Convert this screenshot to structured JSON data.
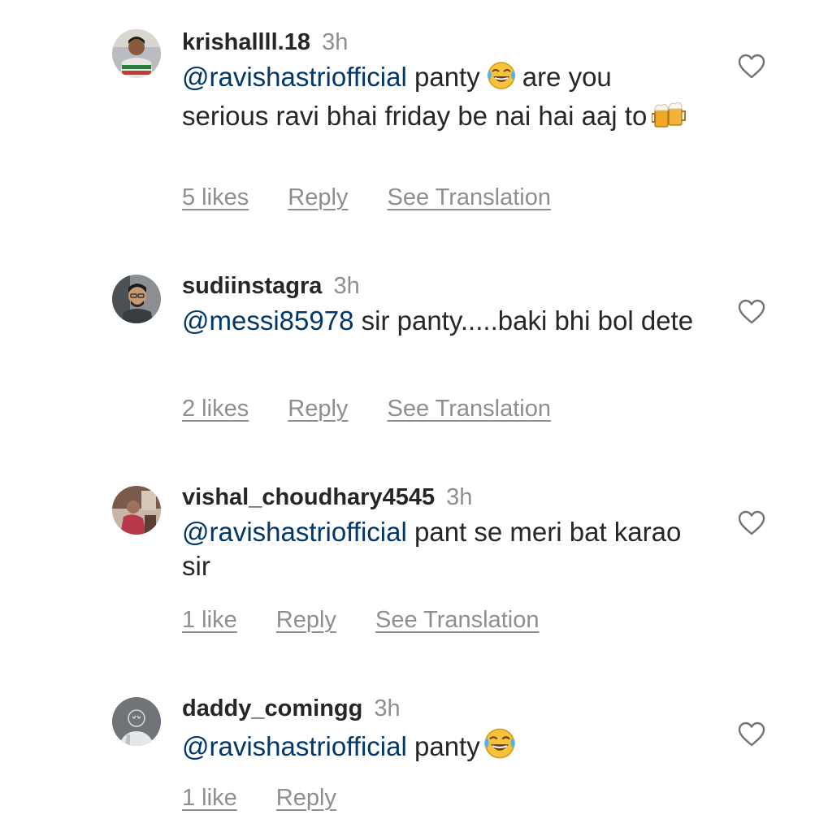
{
  "comments": [
    {
      "username": "krishallll.18",
      "time": "3h",
      "mention": "@ravishastriofficial",
      "text_before_emoji": "panty",
      "text_after_emoji": "are you serious ravi bhai friday be nai hai aaj to",
      "emojis": [
        "tears-of-joy-emoji",
        "beer-mugs-emoji"
      ],
      "likes": "5 likes",
      "reply": "Reply",
      "translate": "See Translation"
    },
    {
      "username": "sudiinstagra",
      "time": "3h",
      "mention": "@messi85978",
      "text": "sir panty.....baki bhi bol dete",
      "likes": "2 likes",
      "reply": "Reply",
      "translate": "See Translation"
    },
    {
      "username": "vishal_choudhary4545",
      "time": "3h",
      "mention": "@ravishastriofficial",
      "text": "pant se meri bat karao sir",
      "likes": "1 like",
      "reply": "Reply",
      "translate": "See Translation"
    },
    {
      "username": "daddy_comingg",
      "time": "3h",
      "mention": "@ravishastriofficial",
      "text": "panty",
      "emojis": [
        "tears-of-joy-emoji"
      ],
      "likes": "1 like",
      "reply": "Reply"
    }
  ],
  "colors": {
    "text": "#262626",
    "secondary": "#8e8e8e",
    "mention": "#00376b"
  }
}
